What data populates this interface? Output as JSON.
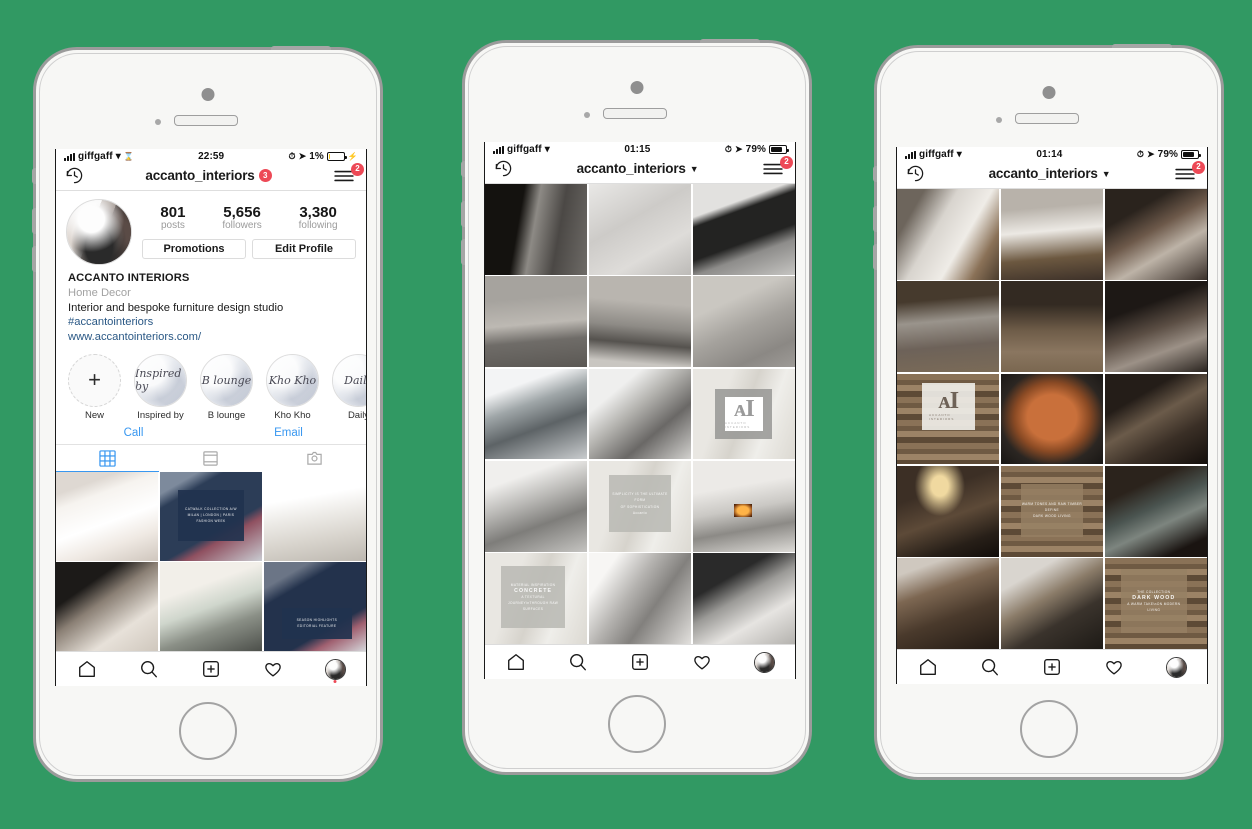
{
  "background_color": "#319963",
  "phones": [
    {
      "id": "phone-profile",
      "status": {
        "carrier": "giffgaff",
        "time": "22:59",
        "battery_percent": "1%",
        "battery_level": 0.08,
        "battery_charging": true,
        "wifi_icon": "wifi-icon",
        "location_icon": "location-arrow-icon",
        "alarm_icon": "alarm-icon"
      },
      "nav": {
        "back_icon": "history-clock-icon",
        "title": "accanto_interiors",
        "title_badge": "3",
        "menu_icon": "hamburger-menu-icon",
        "menu_badge": "2",
        "has_chevron": false
      },
      "profile": {
        "avatar": "profile-photo",
        "stats": [
          {
            "value": "801",
            "label": "posts"
          },
          {
            "value": "5,656",
            "label": "followers"
          },
          {
            "value": "3,380",
            "label": "following"
          }
        ],
        "buttons": [
          "Promotions",
          "Edit Profile"
        ],
        "name": "ACCANTO INTERIORS",
        "category": "Home Decor",
        "bio": "Interior and bespoke furniture design studio",
        "hashtag": "#accantointeriors",
        "website": "www.accantointeriors.com/",
        "highlights": [
          {
            "label": "New",
            "script": "",
            "is_new": true
          },
          {
            "label": "Inspired by",
            "script": "Inspired by",
            "is_new": false
          },
          {
            "label": "B lounge",
            "script": "B lounge",
            "is_new": false
          },
          {
            "label": "Kho Kho",
            "script": "Kho Kho",
            "is_new": false
          },
          {
            "label": "Daily",
            "script": "Daily",
            "is_new": false
          }
        ],
        "contact": [
          "Call",
          "Email"
        ],
        "tabs": [
          {
            "icon": "grid-tab-icon",
            "active": true
          },
          {
            "icon": "list-tab-icon",
            "active": false
          },
          {
            "icon": "tagged-tab-icon",
            "active": false
          }
        ]
      },
      "grid": [
        {
          "art": "fabric-white",
          "name": "post-white-fabric"
        },
        {
          "art": "runway-navy",
          "name": "post-runway-navy",
          "overlay": {
            "title": "CATWALK COLLECTION A/W",
            "sub": "MILAN | LONDON | PARIS",
            "meta": "FASHION WEEK"
          }
        },
        {
          "art": "living-bright",
          "name": "post-bright-living-room"
        },
        {
          "art": "fabric-dark",
          "name": "post-dark-fabric"
        },
        {
          "art": "runway-2",
          "name": "post-runway-white-gown"
        },
        {
          "art": "runway-3",
          "name": "post-runway-navy-2",
          "overlay": {
            "title": "SEASON HIGHLIGHTS",
            "sub": "EDITORIAL FEATURE",
            "meta": ""
          }
        }
      ],
      "tabbar": [
        "home-icon",
        "search-icon",
        "add-post-icon",
        "heart-icon",
        "profile-avatar-icon"
      ]
    },
    {
      "id": "phone-grid-grey",
      "status": {
        "carrier": "giffgaff",
        "time": "01:15",
        "battery_percent": "79%",
        "battery_level": 0.79,
        "battery_charging": false,
        "wifi_icon": "wifi-icon",
        "location_icon": "location-arrow-icon",
        "alarm_icon": "alarm-icon"
      },
      "nav": {
        "back_icon": "history-clock-icon",
        "title": "accanto_interiors",
        "title_badge": "",
        "menu_icon": "hamburger-menu-icon",
        "menu_badge": "2",
        "has_chevron": true
      },
      "grid": [
        {
          "art": "bed-grey",
          "name": "tile-bedroom-fireplace"
        },
        {
          "art": "concrete",
          "name": "tile-concrete-wall"
        },
        {
          "art": "chair-dark",
          "name": "tile-black-lounge-chair"
        },
        {
          "art": "bed-grey",
          "name": "tile-bed-left"
        },
        {
          "art": "bed-grey",
          "name": "tile-bed-centre"
        },
        {
          "art": "concrete",
          "name": "tile-rug-book"
        },
        {
          "art": "mod-house",
          "name": "tile-modern-house"
        },
        {
          "art": "mod-room",
          "name": "tile-modern-room-vase"
        },
        {
          "art": "wood-light",
          "name": "tile-logo-ai",
          "logo": true
        },
        {
          "art": "living-grey",
          "name": "tile-grey-sofa-living"
        },
        {
          "art": "wood-light",
          "name": "tile-quote-card",
          "overlay": {
            "title": "SIMPLICITY IS THE ULTIMATE FORM",
            "sub": "OF SOPHISTICATION",
            "meta": "Accanto"
          }
        },
        {
          "art": "fireplace",
          "name": "tile-fireplace-living"
        },
        {
          "art": "wood-light",
          "name": "tile-concrete-card",
          "overlay": {
            "title": "MATERIAL  INSPIRATION",
            "sub": "CONCRETE",
            "meta": "A TEXTURAL JOURNEY\\nTHROUGH RAW SURFACES"
          }
        },
        {
          "art": "knit",
          "name": "tile-knit-throw"
        },
        {
          "art": "sofa-dark",
          "name": "tile-dark-sofa-room"
        }
      ],
      "tabbar": [
        "home-icon",
        "search-icon",
        "add-post-icon",
        "heart-icon",
        "profile-avatar-icon"
      ]
    },
    {
      "id": "phone-grid-wood",
      "status": {
        "carrier": "giffgaff",
        "time": "01:14",
        "battery_percent": "79%",
        "battery_level": 0.79,
        "battery_charging": false,
        "wifi_icon": "wifi-icon",
        "location_icon": "location-arrow-icon",
        "alarm_icon": "alarm-icon"
      },
      "nav": {
        "back_icon": "history-clock-icon",
        "title": "accanto_interiors",
        "title_badge": "",
        "menu_icon": "hamburger-menu-icon",
        "menu_badge": "2",
        "has_chevron": true
      },
      "grid": [
        {
          "art": "bed-wood",
          "name": "tile-bed-wood-left"
        },
        {
          "art": "bed-wood",
          "name": "tile-bed-wood-centre"
        },
        {
          "art": "night-stand",
          "name": "tile-night-stand"
        },
        {
          "art": "wood-warm",
          "name": "tile-wood-floor-left"
        },
        {
          "art": "wood-warm",
          "name": "tile-wood-floor-centre"
        },
        {
          "art": "dark-sofa",
          "name": "tile-throw-armchair"
        },
        {
          "art": "wood-planks",
          "name": "tile-logo-ai-wood",
          "logo": true
        },
        {
          "art": "copper",
          "name": "tile-copper-bowl"
        },
        {
          "art": "dark-room",
          "name": "tile-dark-fireplace-room"
        },
        {
          "art": "chandelier",
          "name": "tile-chandelier-dining"
        },
        {
          "art": "wood-planks",
          "name": "tile-wood-quote-card",
          "overlay": {
            "title": "WARM TONES AND RAW TIMBER",
            "sub": "DEFINE",
            "meta": "DARK WOOD LIVING"
          }
        },
        {
          "art": "dark-green-sofa",
          "name": "tile-green-sofa"
        },
        {
          "art": "library",
          "name": "tile-library-shelves"
        },
        {
          "art": "coffee",
          "name": "tile-coffee-still-life"
        },
        {
          "art": "wood-planks",
          "name": "tile-darkwood-card",
          "overlay": {
            "title": "THE COLLECTION",
            "sub": "DARK WOOD",
            "meta": "A WARM TAKE\\nON MODERN LIVING"
          }
        }
      ],
      "tabbar": [
        "home-icon",
        "search-icon",
        "add-post-icon",
        "heart-icon",
        "profile-avatar-icon"
      ]
    }
  ]
}
